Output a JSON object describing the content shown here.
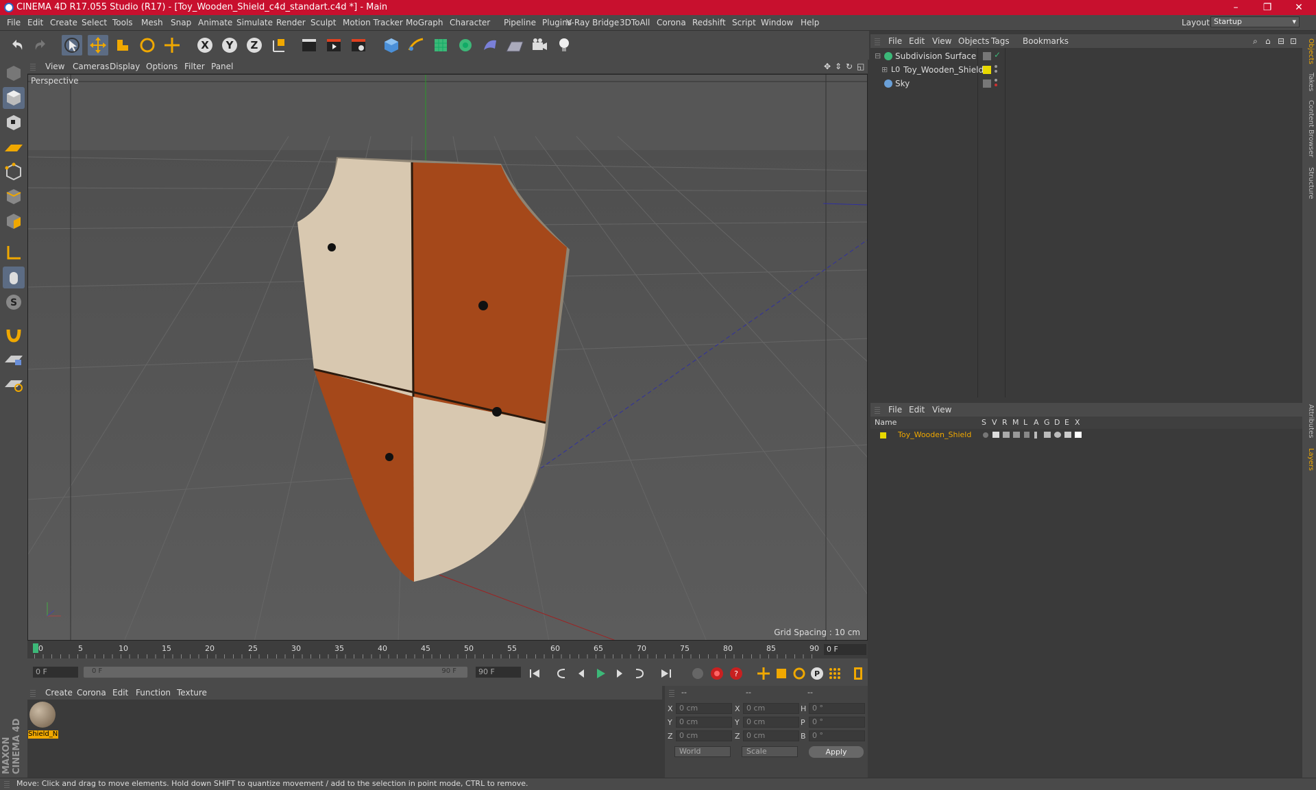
{
  "window": {
    "title": "CINEMA 4D R17.055 Studio (R17) - [Toy_Wooden_Shield_c4d_standart.c4d *] - Main",
    "minimize": "–",
    "maximize": "❐",
    "close": "✕"
  },
  "menubar": {
    "items": [
      "File",
      "Edit",
      "Create",
      "Select",
      "Tools",
      "Mesh",
      "Snap",
      "Animate",
      "Simulate",
      "Render",
      "Sculpt",
      "Motion Tracker",
      "MoGraph",
      "Character",
      "Pipeline",
      "Plugins",
      "V-Ray Bridge",
      "3DToAll",
      "Corona",
      "Redshift",
      "Script",
      "Window",
      "Help"
    ],
    "layout_label": "Layout:",
    "layout_value": "Startup"
  },
  "viewport": {
    "menu": [
      "View",
      "Cameras",
      "Display",
      "Options",
      "Filter",
      "Panel"
    ],
    "label": "Perspective",
    "grid_spacing": "Grid Spacing : 10 cm"
  },
  "timeline": {
    "ticks": [
      "0",
      "5",
      "10",
      "15",
      "20",
      "25",
      "30",
      "35",
      "40",
      "45",
      "50",
      "55",
      "60",
      "65",
      "70",
      "75",
      "80",
      "85",
      "90"
    ],
    "current_frame": "0 F",
    "start_field": "0 F",
    "slider_start": "0 F",
    "slider_end": "90 F",
    "end_field": "90 F"
  },
  "material_panel": {
    "menu": [
      "Create",
      "Corona",
      "Edit",
      "Function",
      "Texture"
    ],
    "material_name": "Shield_N"
  },
  "coords": {
    "header": [
      "--",
      "--",
      "--"
    ],
    "rows": [
      {
        "l1": "X",
        "v1": "0 cm",
        "l2": "X",
        "v2": "0 cm",
        "l3": "H",
        "v3": "0 °"
      },
      {
        "l1": "Y",
        "v1": "0 cm",
        "l2": "Y",
        "v2": "0 cm",
        "l3": "P",
        "v3": "0 °"
      },
      {
        "l1": "Z",
        "v1": "0 cm",
        "l2": "Z",
        "v2": "0 cm",
        "l3": "B",
        "v3": "0 °"
      }
    ],
    "space": "World",
    "mode": "Scale",
    "apply": "Apply"
  },
  "objects_panel": {
    "menu": [
      "File",
      "Edit",
      "View",
      "Objects",
      "Tags",
      "Bookmarks"
    ],
    "items": [
      {
        "name": "Subdivision Surface"
      },
      {
        "name": "Toy_Wooden_Shield"
      },
      {
        "name": "Sky"
      }
    ]
  },
  "layers_panel": {
    "menu": [
      "File",
      "Edit",
      "View"
    ],
    "columns": [
      "Name",
      "S",
      "V",
      "R",
      "M",
      "L",
      "A",
      "G",
      "D",
      "E",
      "X"
    ],
    "items": [
      {
        "name": "Toy_Wooden_Shield"
      }
    ]
  },
  "right_tabs": [
    "Objects",
    "Takes",
    "Content Browser",
    "Structure",
    "Attributes",
    "Layers"
  ],
  "status": "Move: Click and drag to move elements. Hold down SHIFT to quantize movement / add to the selection in point mode, CTRL to remove.",
  "logo": "MAXON CINEMA 4D",
  "colors": {
    "title_bar": "#c8102e",
    "accent": "#f0a800",
    "panel": "#4a4a4a",
    "viewport": "#555555"
  }
}
